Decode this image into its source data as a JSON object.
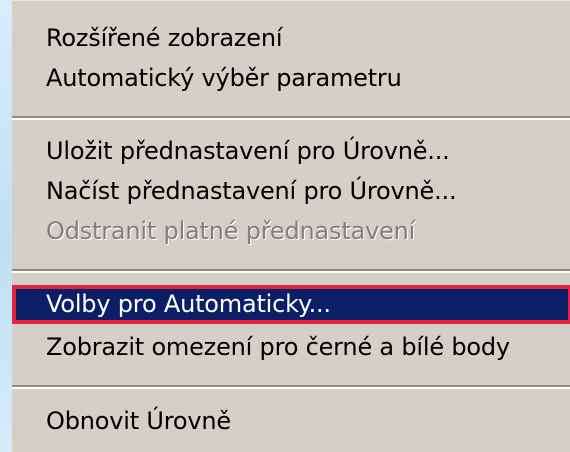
{
  "menu": {
    "items": [
      {
        "label": "Rozšířené zobrazení",
        "enabled": true
      },
      {
        "label": "Automatický výběr parametru",
        "enabled": true
      },
      {
        "label": "Uložit přednastavení pro Úrovně...",
        "enabled": true
      },
      {
        "label": "Načíst přednastavení pro Úrovně...",
        "enabled": true
      },
      {
        "label": "Odstranit platné přednastavení",
        "enabled": false
      },
      {
        "label": "Volby pro Automaticky...",
        "enabled": true,
        "highlighted": true
      },
      {
        "label": "Zobrazit omezení pro černé a bílé body",
        "enabled": true
      },
      {
        "label": "Obnovit Úrovně",
        "enabled": true
      }
    ]
  },
  "colors": {
    "menu_background": "#d4d0c8",
    "highlight_background": "#0a1f68",
    "highlight_border": "#e0243b",
    "disabled_text": "#808080",
    "desktop_background": "#cfe6f7"
  }
}
